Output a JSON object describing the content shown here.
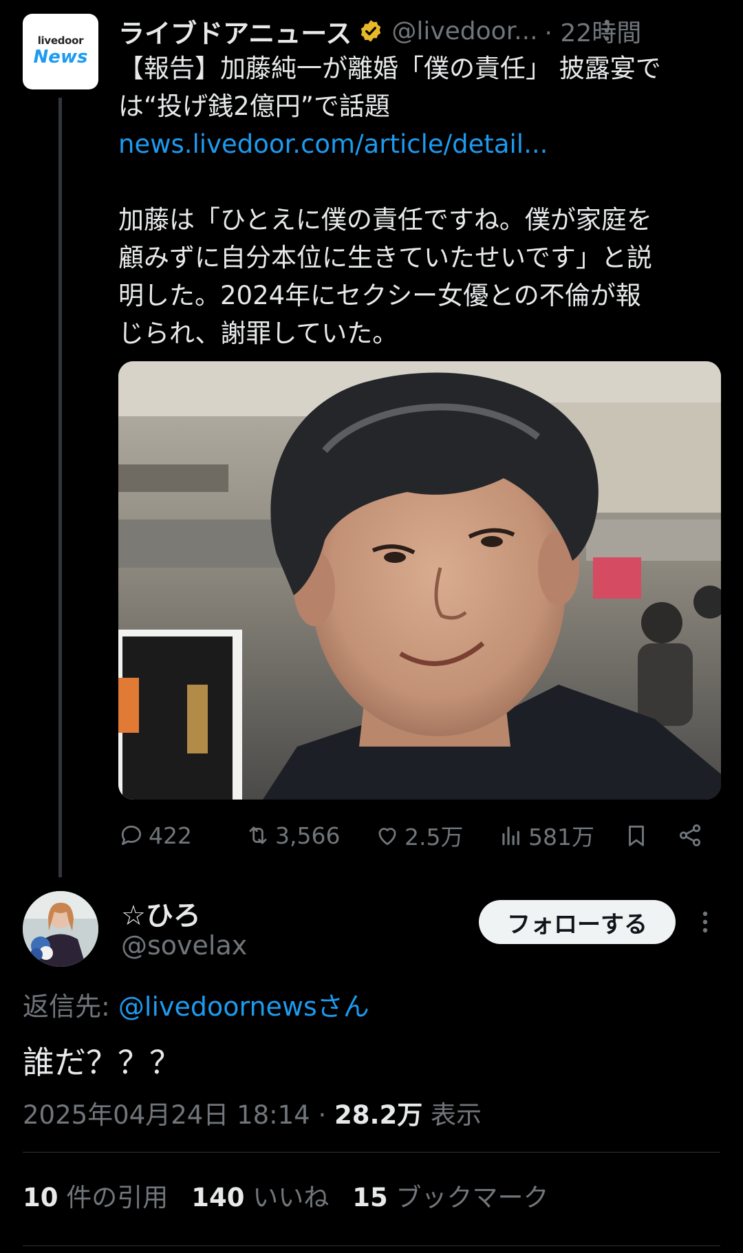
{
  "parent_tweet": {
    "avatar_top": "livedoor",
    "avatar_bottom": "News",
    "display_name": "ライブドアニュース",
    "handle": "@livedoor...",
    "time": "· 22時間",
    "text_lines": [
      "【報告】加藤純一が離婚「僕の責任」 披露宴で",
      "は“投げ銭2億円”で話題"
    ],
    "link": "news.livedoor.com/article/detail...",
    "body_lines": [
      "加藤は「ひとえに僕の責任ですね。僕が家庭を",
      "顧みずに自分本位に生きていたせいです」と説",
      "明した。2024年にセクシー女優との不倫が報",
      "じられ、謝罪していた。"
    ],
    "actions": {
      "replies": "422",
      "retweets": "3,566",
      "likes": "2.5万",
      "views": "581万"
    }
  },
  "reply": {
    "display_name": "☆ひろ",
    "handle": "@sovelax",
    "follow_label": "フォローする",
    "reply_to_prefix": "返信先: ",
    "reply_to_mention": "@livedoornewsさん",
    "text": "誰だ？？？",
    "timestamp": "2025年04月24日 18:14 · ",
    "views_count": "28.2万",
    "views_label": " 表示",
    "stats": {
      "quotes_count": "10",
      "quotes_label": " 件の引用",
      "likes_count": "140",
      "likes_label": " いいね",
      "bookmarks_count": "15",
      "bookmarks_label": " ブックマーク"
    }
  },
  "colors": {
    "background": "#000000",
    "text": "#e7e9ea",
    "secondary": "#71767b",
    "link": "#1d9bf0",
    "verified": "#e8b829"
  }
}
